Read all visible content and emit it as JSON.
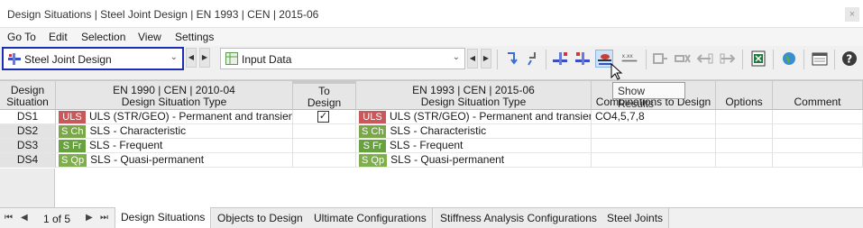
{
  "window": {
    "title": "Design Situations | Steel Joint Design | EN 1993 | CEN | 2015-06",
    "close_label": "×"
  },
  "menu": [
    "Go To",
    "Edit",
    "Selection",
    "View",
    "Settings"
  ],
  "toolbar": {
    "module_select": "Steel Joint Design",
    "table_select": "Input Data",
    "tooltip": "Show Results"
  },
  "grid": {
    "headers": {
      "ds": "Design\nSituation",
      "en1990": "EN 1990 | CEN | 2010-04\nDesign Situation Type",
      "to_design": "To\nDesign",
      "en1993": "EN 1993 | CEN | 2015-06\nDesign Situation Type",
      "combinations": "Combinations to Design",
      "options": "Options",
      "comment": "Comment"
    },
    "rows": [
      {
        "ds": "DS1",
        "badge1": "ULS",
        "type1": "ULS (STR/GEO) - Permanent and transient...",
        "to_design": "✓",
        "badge2": "ULS",
        "type2": "ULS (STR/GEO) - Permanent and transient",
        "combinations": "CO4,5,7,8",
        "options": "",
        "comment": "",
        "badge_color": "#c9585a"
      },
      {
        "ds": "DS2",
        "badge1": "S Ch",
        "type1": "SLS - Characteristic",
        "to_design": "",
        "badge2": "S Ch",
        "type2": "SLS - Characteristic",
        "combinations": "",
        "options": "",
        "comment": "",
        "badge_color": "#7aa748"
      },
      {
        "ds": "DS3",
        "badge1": "S Fr",
        "type1": "SLS - Frequent",
        "to_design": "",
        "badge2": "S Fr",
        "type2": "SLS - Frequent",
        "combinations": "",
        "options": "",
        "comment": "",
        "badge_color": "#68a23f"
      },
      {
        "ds": "DS4",
        "badge1": "S Qp",
        "type1": "SLS - Quasi-permanent",
        "to_design": "",
        "badge2": "S Qp",
        "type2": "SLS - Quasi-permanent",
        "combinations": "",
        "options": "",
        "comment": "",
        "badge_color": "#7fae4c"
      }
    ]
  },
  "pager": {
    "text": "1 of 5"
  },
  "tabs": [
    "Design Situations",
    "Objects to Design",
    "Ultimate Configurations",
    "Stiffness Analysis Configurations",
    "Steel Joints"
  ],
  "active_tab": "Design Situations"
}
